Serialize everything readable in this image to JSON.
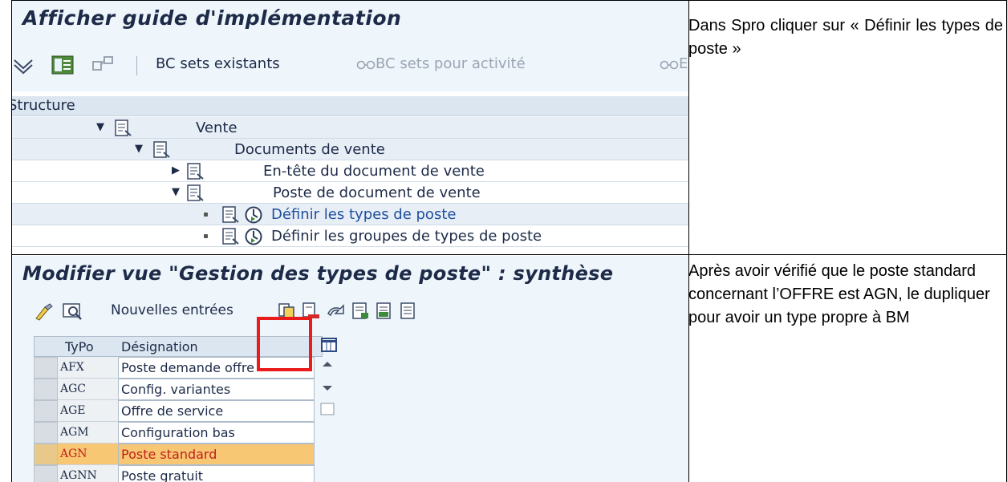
{
  "top_screen": {
    "title": "Afficher guide d'implémentation",
    "toolbar": {
      "bc_sets_existants": "BC sets existants",
      "bc_sets_pour_activite": "BC sets pour activité",
      "cut_glyph": "E"
    },
    "structure_label": "Structure",
    "tree": [
      {
        "label": "Vente",
        "type": "expanded"
      },
      {
        "label": "Documents de vente",
        "type": "expanded"
      },
      {
        "label": "En-tête du document de vente",
        "type": "collapsed"
      },
      {
        "label": "Poste de document de vente",
        "type": "expanded"
      },
      {
        "label": "Définir les types de poste",
        "type": "activity"
      },
      {
        "label": "Définir les groupes de types de poste",
        "type": "activity"
      }
    ]
  },
  "top_note": "Dans Spro cliquer sur « Définir les types de poste »",
  "bottom_screen": {
    "title": "Modifier vue \"Gestion des types de poste\" : synthèse",
    "toolbar": {
      "nouvelles_entrees": "Nouvelles entrées"
    },
    "grid": {
      "columns": [
        "TyPo",
        "Désignation"
      ],
      "rows": [
        {
          "code": "AFX",
          "designation": "Poste demande offre"
        },
        {
          "code": "AGC",
          "designation": "Config. variantes"
        },
        {
          "code": "AGE",
          "designation": "Offre de service"
        },
        {
          "code": "AGM",
          "designation": "Configuration bas"
        },
        {
          "code": "AGN",
          "designation": "Poste standard",
          "highlighted": true
        },
        {
          "code": "AGNN",
          "designation": "Poste gratuit"
        }
      ]
    },
    "highlight_color": "#ea1b1b"
  },
  "bottom_note": "Après avoir vérifié que le poste standard concernant l’OFFRE est AGN, le dupliquer pour avoir un type propre à BM"
}
